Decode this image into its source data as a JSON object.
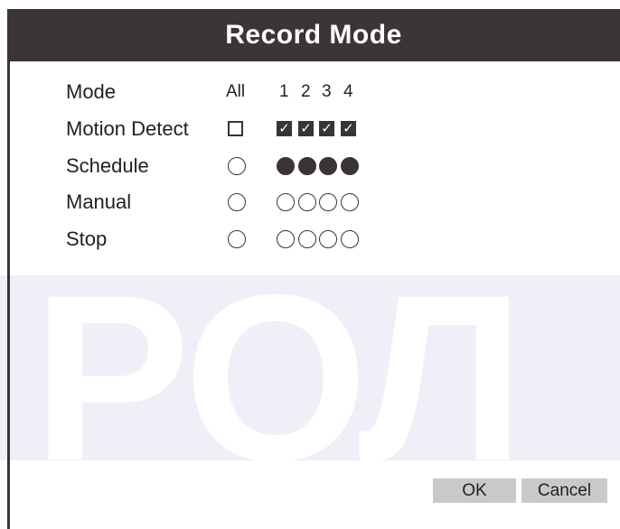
{
  "dialog": {
    "title": "Record Mode",
    "watermark": "РОЛ"
  },
  "header": {
    "label": "Mode",
    "all": "All",
    "channels": [
      "1",
      "2",
      "3",
      "4"
    ]
  },
  "modes": [
    {
      "label": "Motion Detect",
      "control": "checkbox",
      "all": false,
      "channels": [
        true,
        true,
        true,
        true
      ]
    },
    {
      "label": "Schedule",
      "control": "radio",
      "all": false,
      "channels": [
        true,
        true,
        true,
        true
      ]
    },
    {
      "label": "Manual",
      "control": "radio",
      "all": false,
      "channels": [
        false,
        false,
        false,
        false
      ]
    },
    {
      "label": "Stop",
      "control": "radio",
      "all": false,
      "channels": [
        false,
        false,
        false,
        false
      ]
    }
  ],
  "buttons": {
    "ok": "OK",
    "cancel": "Cancel"
  },
  "colors": {
    "title_bar": "#3c3535",
    "button": "#c9c9c9",
    "watermark_band": "#efeff8"
  }
}
